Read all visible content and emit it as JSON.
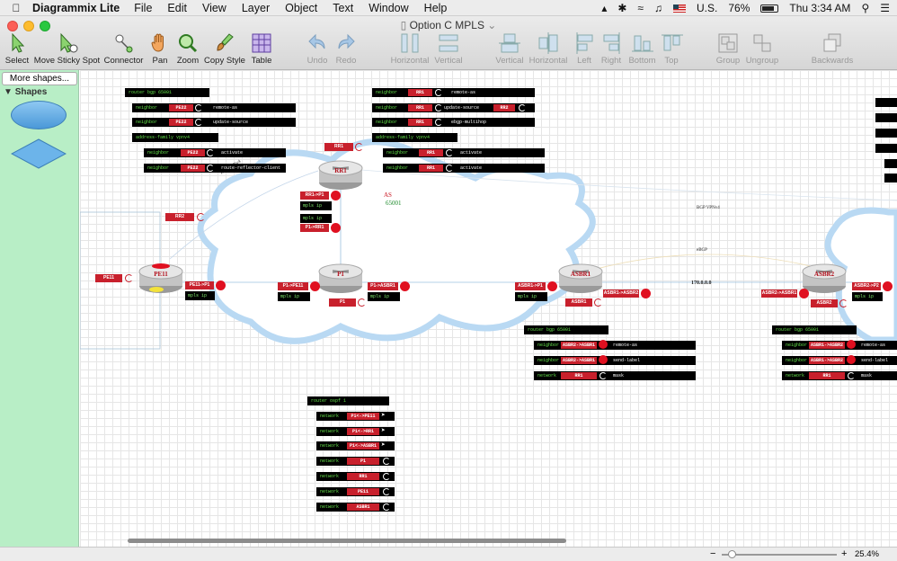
{
  "menubar": {
    "app": "Diagrammix Lite",
    "items": [
      "File",
      "Edit",
      "View",
      "Layer",
      "Object",
      "Text",
      "Window",
      "Help"
    ],
    "input_source": "U.S.",
    "battery": "76%",
    "clock": "Thu 3:34 AM"
  },
  "window": {
    "title": "Option C MPLS"
  },
  "toolbar": {
    "select": "Select",
    "move_sticky": "Move Sticky Spot",
    "connector": "Connector",
    "pan": "Pan",
    "zoom": "Zoom",
    "copy_style": "Copy Style",
    "table": "Table",
    "undo": "Undo",
    "redo": "Redo",
    "horizontal": "Horizontal",
    "vertical": "Vertical",
    "align_vertical": "Vertical",
    "align_horizontal": "Horizontal",
    "left": "Left",
    "right": "Right",
    "bottom": "Bottom",
    "top": "Top",
    "group": "Group",
    "ungroup": "Ungroup",
    "backwards": "Backwards"
  },
  "sidebar": {
    "more_shapes": "More shapes...",
    "section": "Shapes"
  },
  "diagram": {
    "as_label": "AS",
    "as_number": "65001",
    "bgp_vpnv4_left": "BGP VPNv4",
    "bgp_vpnv4_right": "BGP VPNv4",
    "ebgp": "eBGP",
    "link_addr": "170.0.0.0",
    "routers": {
      "rr1": "RR1",
      "pe11": "PE11",
      "p1": "P1",
      "asbr1": "ASBR1",
      "asbr2": "ASBR2"
    },
    "tags": {
      "rr1_top": "RR1",
      "rr1_p1": "RR1->P1",
      "rr2": "RR2",
      "pe11": "PE11",
      "pe11_p1": "PE11->P1",
      "p1_pe11": "P1->PE11",
      "p1_rr1": "P1->RR1",
      "p1_asbr1": "P1->ASBR1",
      "p1": "P1",
      "asbr1_p1": "ASBR1->P1",
      "asbr1_asbr2": "ASBR1->ASBR2",
      "asbr1": "ASBR1",
      "asbr2_asbr1": "ASBR2->ASBR1",
      "asbr2_p2": "ASBR2->P2",
      "asbr2": "ASBR2"
    },
    "mpls_ip": "mpls ip",
    "pe_config": {
      "header": "router bgp 65001",
      "rows": [
        {
          "cmd": "neighbor",
          "val": "PE22",
          "tail": "remote-as"
        },
        {
          "cmd": "neighbor",
          "val": "PE22",
          "tail": "update-source"
        }
      ],
      "af": "address-family vpnv4",
      "af_rows": [
        {
          "cmd": "neighbor",
          "val": "PE22",
          "tail": "activate"
        },
        {
          "cmd": "neighbor",
          "val": "PE22",
          "tail": "route-reflector-client"
        }
      ]
    },
    "rr_config": {
      "rows": [
        {
          "cmd": "neighbor",
          "val": "RR1",
          "tail": "remote-as"
        },
        {
          "cmd": "neighbor",
          "val": "RR1",
          "tail": "update-source",
          "extra": "RR2"
        },
        {
          "cmd": "neighbor",
          "val": "RR1",
          "tail": "ebgp-multihop"
        }
      ],
      "af": "address-family vpnv4",
      "af_rows": [
        {
          "cmd": "neighbor",
          "val": "RR1",
          "tail": "activate"
        },
        {
          "cmd": "neighbor",
          "val": "RR1",
          "tail": "activate"
        }
      ]
    },
    "asbr1_config": {
      "header": "router bgp 65001",
      "rows": [
        {
          "cmd": "neighbor",
          "val": "ASBR2->ASBR1",
          "tail": "remote-as"
        },
        {
          "cmd": "neighbor",
          "val": "ASBR2->ASBR1",
          "tail": "send-label"
        },
        {
          "cmd": "network",
          "val": "RR1",
          "tail": "mask"
        }
      ]
    },
    "asbr2_config": {
      "header": "router bgp 65001",
      "rows": [
        {
          "cmd": "neighbor",
          "val": "ASBR1->ASBR2",
          "tail": "remote-as"
        },
        {
          "cmd": "neighbor",
          "val": "ASBR1->ASBR2",
          "tail": "send-label"
        },
        {
          "cmd": "network",
          "val": "RR1",
          "tail": "mask"
        }
      ]
    },
    "ospf_config": {
      "header": "router ospf 1",
      "rows": [
        {
          "cmd": "network",
          "val": "P1<->PE11"
        },
        {
          "cmd": "network",
          "val": "P1<->RR1"
        },
        {
          "cmd": "network",
          "val": "P1<->ASBR1"
        },
        {
          "cmd": "network",
          "val": "P1"
        },
        {
          "cmd": "network",
          "val": "RR1"
        },
        {
          "cmd": "network",
          "val": "PE11"
        },
        {
          "cmd": "network",
          "val": "ASBR1"
        }
      ]
    }
  },
  "status": {
    "zoom": "25.4%"
  }
}
